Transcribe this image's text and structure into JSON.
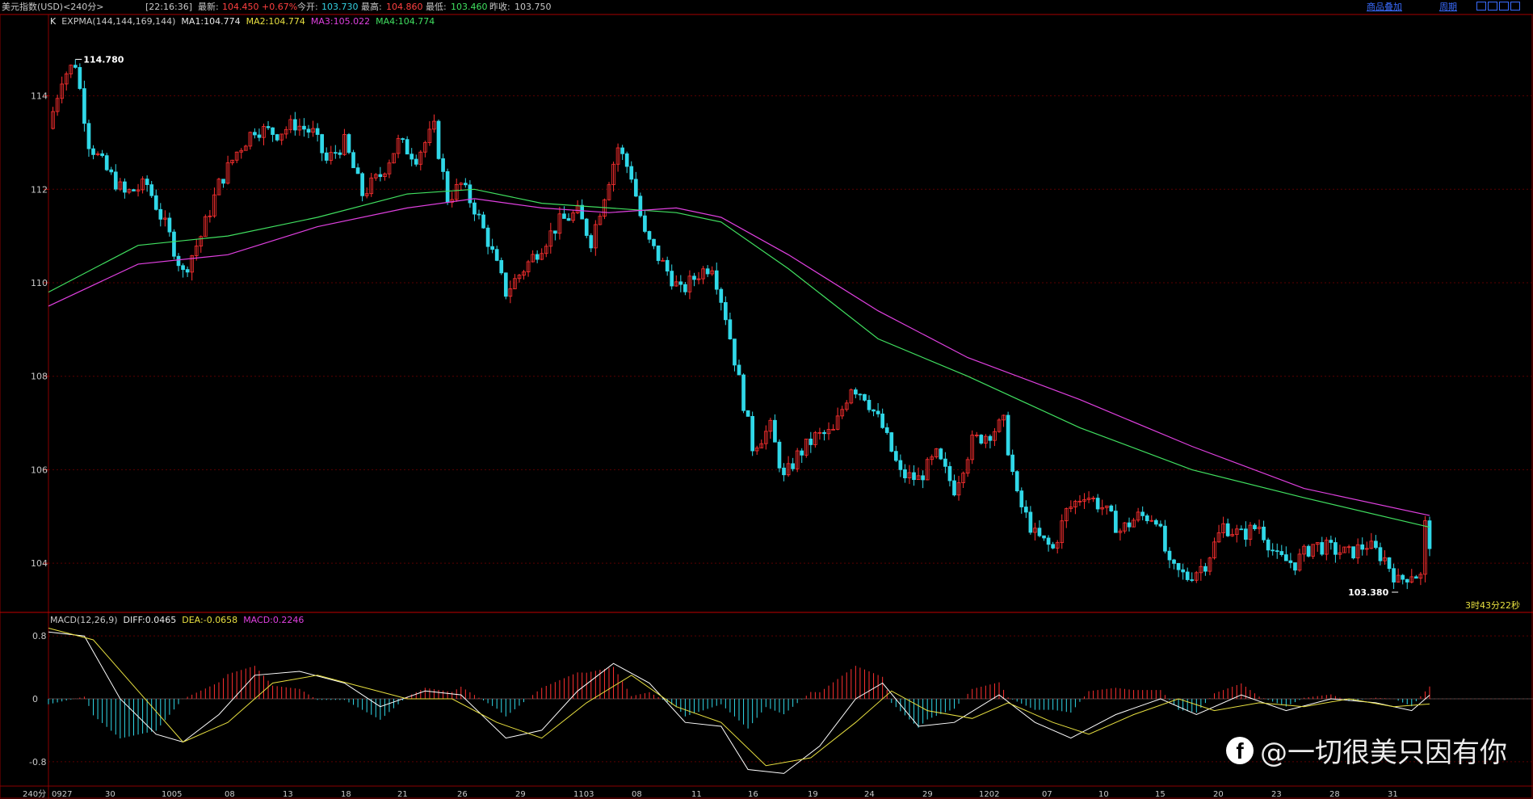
{
  "header": {
    "title": "美元指数(USD)<240分>",
    "time": "[22:16:36]",
    "last_label": "最新:",
    "last_value": "104.450",
    "change": "+0.67%",
    "open_label": "今开:",
    "open_value": "103.730",
    "high_label": "最高:",
    "high_value": "104.860",
    "low_label": "最低:",
    "low_value": "103.460",
    "prev_label": "昨收:",
    "prev_value": "103.750",
    "overlay_link": "商品叠加",
    "period_link": "周期"
  },
  "legend_main": {
    "k": "K",
    "expma": "EXPMA(144,144,169,144)",
    "ma1": "MA1:104.774",
    "ma2": "MA2:104.774",
    "ma3": "MA3:105.022",
    "ma4": "MA4:104.774"
  },
  "legend_macd": {
    "name": "MACD(12,26,9)",
    "diff": "DIFF:0.0465",
    "dea": "DEA:-0.0658",
    "macd": "MACD:0.2246"
  },
  "timer": "3时43分22秒",
  "watermark": "@一切很美只因有你",
  "colors": {
    "up": "#ff3030",
    "down": "#30d8e8",
    "ma_green": "#40e060",
    "ma_magenta": "#e040e0",
    "diff": "#ffffff",
    "dea": "#e8e040",
    "grid": "#5a0000"
  },
  "chart_data": [
    {
      "type": "candlestick",
      "period": "240分",
      "price_axis_ticks": [
        104,
        106,
        108,
        110,
        112,
        114
      ],
      "ylim": [
        103.0,
        115.6
      ],
      "x_labels": [
        "240分",
        "0927",
        "30",
        "1005",
        "08",
        "13",
        "18",
        "21",
        "26",
        "29",
        "1103",
        "08",
        "11",
        "16",
        "19",
        "24",
        "29",
        "1202",
        "07",
        "10",
        "15",
        "20",
        "23",
        "28",
        "31"
      ],
      "annotations": [
        {
          "text": "114.780",
          "value": 114.78,
          "at": "0927-0928"
        },
        {
          "text": "103.380",
          "value": 103.38,
          "at": "late Dec"
        }
      ],
      "close_path": [
        {
          "t": 0,
          "close": 113.3
        },
        {
          "t": 3,
          "close": 114.4
        },
        {
          "t": 6,
          "close": 114.7
        },
        {
          "t": 9,
          "close": 113.0
        },
        {
          "t": 13,
          "close": 112.4
        },
        {
          "t": 17,
          "close": 111.9
        },
        {
          "t": 22,
          "close": 112.1
        },
        {
          "t": 27,
          "close": 111.0
        },
        {
          "t": 30,
          "close": 110.2
        },
        {
          "t": 34,
          "close": 111.0
        },
        {
          "t": 38,
          "close": 112.1
        },
        {
          "t": 42,
          "close": 112.8
        },
        {
          "t": 46,
          "close": 113.3
        },
        {
          "t": 51,
          "close": 113.2
        },
        {
          "t": 55,
          "close": 113.4
        },
        {
          "t": 59,
          "close": 113.2
        },
        {
          "t": 62,
          "close": 112.6
        },
        {
          "t": 66,
          "close": 113.0
        },
        {
          "t": 70,
          "close": 111.9
        },
        {
          "t": 74,
          "close": 112.3
        },
        {
          "t": 78,
          "close": 113.0
        },
        {
          "t": 82,
          "close": 112.7
        },
        {
          "t": 86,
          "close": 113.3
        },
        {
          "t": 89,
          "close": 111.8
        },
        {
          "t": 92,
          "close": 112.1
        },
        {
          "t": 95,
          "close": 111.6
        },
        {
          "t": 98,
          "close": 110.9
        },
        {
          "t": 102,
          "close": 109.8
        },
        {
          "t": 106,
          "close": 110.3
        },
        {
          "t": 110,
          "close": 110.8
        },
        {
          "t": 114,
          "close": 111.3
        },
        {
          "t": 118,
          "close": 111.5
        },
        {
          "t": 121,
          "close": 110.9
        },
        {
          "t": 124,
          "close": 111.9
        },
        {
          "t": 127,
          "close": 112.9
        },
        {
          "t": 130,
          "close": 112.3
        },
        {
          "t": 133,
          "close": 111.0
        },
        {
          "t": 137,
          "close": 110.4
        },
        {
          "t": 141,
          "close": 109.8
        },
        {
          "t": 145,
          "close": 110.2
        },
        {
          "t": 148,
          "close": 110.4
        },
        {
          "t": 151,
          "close": 109.3
        },
        {
          "t": 154,
          "close": 107.9
        },
        {
          "t": 157,
          "close": 106.5
        },
        {
          "t": 161,
          "close": 106.9
        },
        {
          "t": 164,
          "close": 105.8
        },
        {
          "t": 167,
          "close": 106.3
        },
        {
          "t": 171,
          "close": 106.7
        },
        {
          "t": 175,
          "close": 106.8
        },
        {
          "t": 179,
          "close": 107.8
        },
        {
          "t": 182,
          "close": 107.6
        },
        {
          "t": 186,
          "close": 106.9
        },
        {
          "t": 190,
          "close": 105.9
        },
        {
          "t": 194,
          "close": 105.8
        },
        {
          "t": 198,
          "close": 106.3
        },
        {
          "t": 202,
          "close": 105.6
        },
        {
          "t": 206,
          "close": 106.6
        },
        {
          "t": 210,
          "close": 106.8
        },
        {
          "t": 213,
          "close": 107.0
        },
        {
          "t": 216,
          "close": 105.4
        },
        {
          "t": 220,
          "close": 104.6
        },
        {
          "t": 224,
          "close": 104.3
        },
        {
          "t": 227,
          "close": 105.1
        },
        {
          "t": 231,
          "close": 105.5
        },
        {
          "t": 235,
          "close": 105.2
        },
        {
          "t": 239,
          "close": 104.7
        },
        {
          "t": 243,
          "close": 105.0
        },
        {
          "t": 247,
          "close": 105.0
        },
        {
          "t": 250,
          "close": 103.9
        },
        {
          "t": 254,
          "close": 103.7
        },
        {
          "t": 258,
          "close": 104.0
        },
        {
          "t": 262,
          "close": 104.8
        },
        {
          "t": 266,
          "close": 104.6
        },
        {
          "t": 270,
          "close": 104.8
        },
        {
          "t": 274,
          "close": 104.1
        },
        {
          "t": 278,
          "close": 104.0
        },
        {
          "t": 282,
          "close": 104.4
        },
        {
          "t": 286,
          "close": 104.3
        },
        {
          "t": 290,
          "close": 104.2
        },
        {
          "t": 294,
          "close": 104.4
        },
        {
          "t": 298,
          "close": 104.1
        },
        {
          "t": 301,
          "close": 103.6
        },
        {
          "t": 304,
          "close": 103.8
        },
        {
          "t": 306,
          "close": 103.7
        },
        {
          "t": 307,
          "close": 104.8
        },
        {
          "t": 308,
          "close": 104.45
        }
      ],
      "ma_green_path": [
        {
          "t": 0,
          "v": 109.8
        },
        {
          "t": 20,
          "v": 110.8
        },
        {
          "t": 40,
          "v": 111.0
        },
        {
          "t": 60,
          "v": 111.4
        },
        {
          "t": 80,
          "v": 111.9
        },
        {
          "t": 95,
          "v": 112.0
        },
        {
          "t": 110,
          "v": 111.7
        },
        {
          "t": 125,
          "v": 111.6
        },
        {
          "t": 140,
          "v": 111.5
        },
        {
          "t": 150,
          "v": 111.3
        },
        {
          "t": 165,
          "v": 110.3
        },
        {
          "t": 185,
          "v": 108.8
        },
        {
          "t": 205,
          "v": 108.0
        },
        {
          "t": 230,
          "v": 106.9
        },
        {
          "t": 255,
          "v": 106.0
        },
        {
          "t": 280,
          "v": 105.4
        },
        {
          "t": 308,
          "v": 104.77
        }
      ],
      "ma_magenta_path": [
        {
          "t": 0,
          "v": 109.5
        },
        {
          "t": 20,
          "v": 110.4
        },
        {
          "t": 40,
          "v": 110.6
        },
        {
          "t": 60,
          "v": 111.2
        },
        {
          "t": 80,
          "v": 111.6
        },
        {
          "t": 95,
          "v": 111.8
        },
        {
          "t": 110,
          "v": 111.6
        },
        {
          "t": 125,
          "v": 111.5
        },
        {
          "t": 140,
          "v": 111.6
        },
        {
          "t": 150,
          "v": 111.4
        },
        {
          "t": 165,
          "v": 110.6
        },
        {
          "t": 185,
          "v": 109.4
        },
        {
          "t": 205,
          "v": 108.4
        },
        {
          "t": 230,
          "v": 107.5
        },
        {
          "t": 255,
          "v": 106.5
        },
        {
          "t": 280,
          "v": 105.6
        },
        {
          "t": 308,
          "v": 105.02
        }
      ]
    },
    {
      "type": "macd",
      "name": "MACD(12,26,9)",
      "y_ticks": [
        0.8,
        0,
        -0.8
      ],
      "ylim": [
        -1.1,
        1.1
      ],
      "diff_path": [
        {
          "t": 0,
          "v": 0.85
        },
        {
          "t": 8,
          "v": 0.8
        },
        {
          "t": 16,
          "v": 0.0
        },
        {
          "t": 24,
          "v": -0.45
        },
        {
          "t": 30,
          "v": -0.55
        },
        {
          "t": 38,
          "v": -0.2
        },
        {
          "t": 46,
          "v": 0.3
        },
        {
          "t": 56,
          "v": 0.35
        },
        {
          "t": 66,
          "v": 0.2
        },
        {
          "t": 74,
          "v": -0.1
        },
        {
          "t": 84,
          "v": 0.1
        },
        {
          "t": 92,
          "v": 0.05
        },
        {
          "t": 102,
          "v": -0.5
        },
        {
          "t": 110,
          "v": -0.4
        },
        {
          "t": 118,
          "v": 0.1
        },
        {
          "t": 126,
          "v": 0.45
        },
        {
          "t": 134,
          "v": 0.2
        },
        {
          "t": 142,
          "v": -0.3
        },
        {
          "t": 150,
          "v": -0.35
        },
        {
          "t": 156,
          "v": -0.9
        },
        {
          "t": 164,
          "v": -0.95
        },
        {
          "t": 172,
          "v": -0.6
        },
        {
          "t": 180,
          "v": 0.0
        },
        {
          "t": 186,
          "v": 0.2
        },
        {
          "t": 194,
          "v": -0.35
        },
        {
          "t": 202,
          "v": -0.3
        },
        {
          "t": 212,
          "v": 0.05
        },
        {
          "t": 220,
          "v": -0.3
        },
        {
          "t": 228,
          "v": -0.5
        },
        {
          "t": 238,
          "v": -0.2
        },
        {
          "t": 248,
          "v": 0.0
        },
        {
          "t": 256,
          "v": -0.2
        },
        {
          "t": 266,
          "v": 0.05
        },
        {
          "t": 276,
          "v": -0.15
        },
        {
          "t": 286,
          "v": 0.0
        },
        {
          "t": 296,
          "v": -0.05
        },
        {
          "t": 304,
          "v": -0.15
        },
        {
          "t": 308,
          "v": 0.0465
        }
      ],
      "dea_path": [
        {
          "t": 0,
          "v": 0.9
        },
        {
          "t": 10,
          "v": 0.75
        },
        {
          "t": 20,
          "v": 0.1
        },
        {
          "t": 30,
          "v": -0.55
        },
        {
          "t": 40,
          "v": -0.3
        },
        {
          "t": 50,
          "v": 0.2
        },
        {
          "t": 60,
          "v": 0.3
        },
        {
          "t": 70,
          "v": 0.15
        },
        {
          "t": 80,
          "v": 0.0
        },
        {
          "t": 90,
          "v": 0.0
        },
        {
          "t": 100,
          "v": -0.3
        },
        {
          "t": 110,
          "v": -0.5
        },
        {
          "t": 120,
          "v": -0.05
        },
        {
          "t": 130,
          "v": 0.3
        },
        {
          "t": 140,
          "v": -0.1
        },
        {
          "t": 150,
          "v": -0.3
        },
        {
          "t": 160,
          "v": -0.85
        },
        {
          "t": 170,
          "v": -0.75
        },
        {
          "t": 180,
          "v": -0.3
        },
        {
          "t": 188,
          "v": 0.1
        },
        {
          "t": 196,
          "v": -0.15
        },
        {
          "t": 206,
          "v": -0.25
        },
        {
          "t": 214,
          "v": -0.05
        },
        {
          "t": 224,
          "v": -0.3
        },
        {
          "t": 232,
          "v": -0.45
        },
        {
          "t": 242,
          "v": -0.2
        },
        {
          "t": 252,
          "v": 0.0
        },
        {
          "t": 260,
          "v": -0.15
        },
        {
          "t": 270,
          "v": -0.05
        },
        {
          "t": 280,
          "v": -0.1
        },
        {
          "t": 290,
          "v": 0.0
        },
        {
          "t": 300,
          "v": -0.1
        },
        {
          "t": 308,
          "v": -0.0658
        }
      ]
    }
  ]
}
